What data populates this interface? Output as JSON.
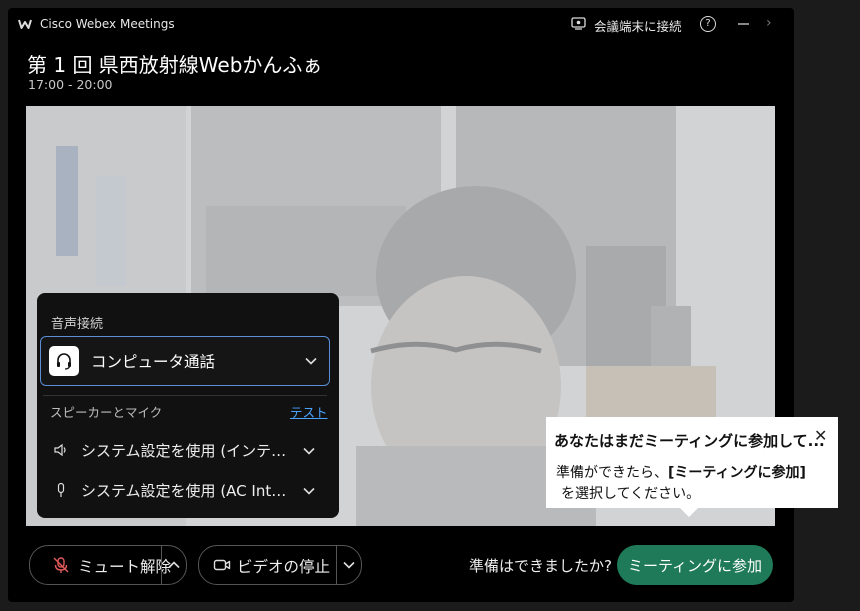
{
  "window": {
    "app_name": "Cisco Webex Meetings",
    "connect_device_label": "会議端末に接続",
    "help_label": "?",
    "close_glyph": "›"
  },
  "meeting": {
    "title": "第 1 回 県西放射線Webかんふぁ",
    "time": "17:00 - 20:00"
  },
  "audio_panel": {
    "heading": "音声接続",
    "selected_option": "コンピュータ通話",
    "section_label": "スピーカーとマイク",
    "test_link": "テスト",
    "speaker_setting": "システム設定を使用 (インテル(...",
    "mic_setting": "システム設定を使用 (AC Inter..."
  },
  "tooltip": {
    "title": "あなたはまだミーティングに参加して...",
    "close_glyph": "✕",
    "body_line1_prefix": "準備ができたら、",
    "body_line1_bold": "[ミーティングに参加]",
    "body_line2": "を選択してください。"
  },
  "controls": {
    "mute_label": "ミュート解除",
    "video_label": "ビデオの停止",
    "ready_question": "準備はできましたか?",
    "join_label": "ミーティングに参加"
  },
  "icons": {
    "app_logo": "webex-logo-icon",
    "connect": "cast-device-icon",
    "audio_option": "headset-icon",
    "speaker": "speaker-icon",
    "mic": "microphone-icon",
    "muted_mic": "muted-microphone-icon",
    "camera": "video-camera-icon"
  },
  "colors": {
    "join_button": "#1f7a5a",
    "muted_icon": "#e05a5a",
    "link": "#4aa3ff",
    "selected_border": "#5a8fd8"
  }
}
